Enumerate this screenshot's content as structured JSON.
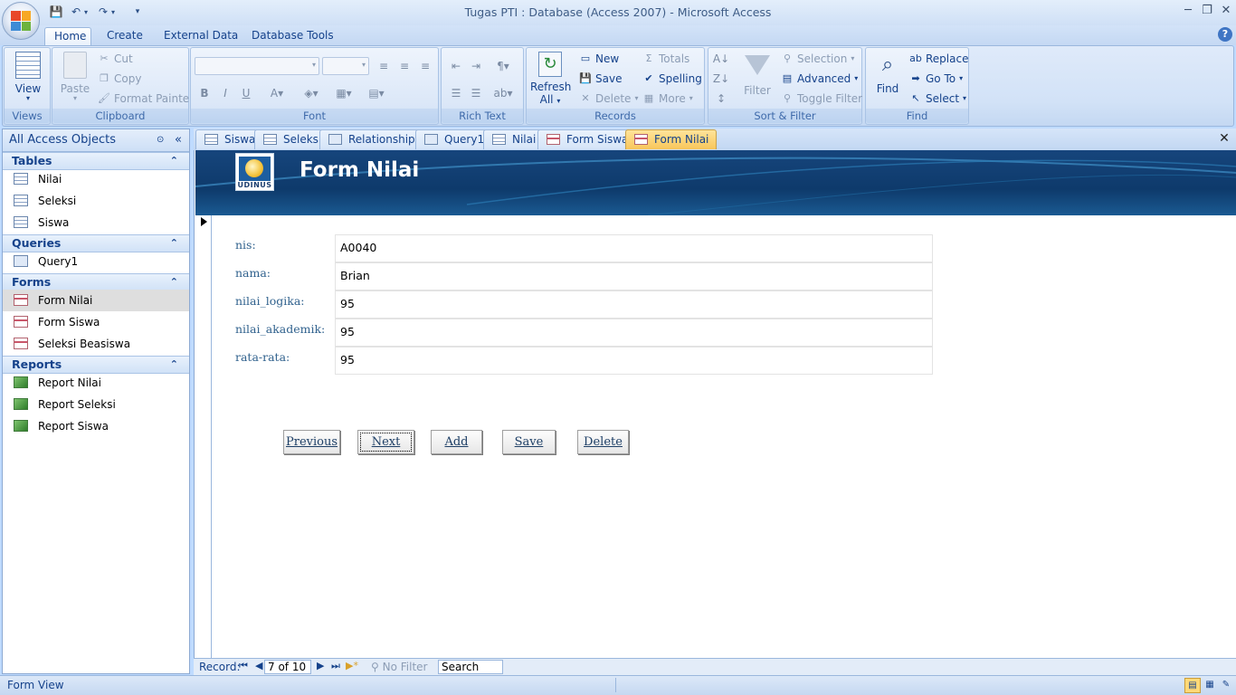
{
  "window": {
    "title": "Tugas PTI : Database (Access 2007) - Microsoft Access",
    "minimize": "─",
    "restore": "❐",
    "close": "✕"
  },
  "ribbon_tabs": [
    "Home",
    "Create",
    "External Data",
    "Database Tools"
  ],
  "groups": {
    "views": {
      "label": "Views",
      "view": "View"
    },
    "clipboard": {
      "label": "Clipboard",
      "paste": "Paste",
      "cut": "Cut",
      "copy": "Copy",
      "format_painter": "Format Painter"
    },
    "font": {
      "label": "Font"
    },
    "rich_text": {
      "label": "Rich Text"
    },
    "records": {
      "label": "Records",
      "refresh": "Refresh",
      "refresh2": "All",
      "new": "New",
      "save": "Save",
      "delete": "Delete",
      "totals": "Totals",
      "spelling": "Spelling",
      "more": "More"
    },
    "sort_filter": {
      "label": "Sort & Filter",
      "filter": "Filter",
      "selection": "Selection",
      "advanced": "Advanced",
      "toggle_filter": "Toggle Filter"
    },
    "find": {
      "label": "Find",
      "find": "Find",
      "replace": "Replace",
      "goto": "Go To",
      "select": "Select"
    }
  },
  "nav": {
    "header": "All Access Objects",
    "tables": {
      "title": "Tables",
      "items": [
        "Nilai",
        "Seleksi",
        "Siswa"
      ]
    },
    "queries": {
      "title": "Queries",
      "items": [
        "Query1"
      ]
    },
    "forms": {
      "title": "Forms",
      "items": [
        "Form Nilai",
        "Form Siswa",
        "Seleksi Beasiswa"
      ]
    },
    "reports": {
      "title": "Reports",
      "items": [
        "Report Nilai",
        "Report Seleksi",
        "Report Siswa"
      ]
    }
  },
  "doc_tabs": [
    "Siswa",
    "Seleksi",
    "Relationships",
    "Query1",
    "Nilai",
    "Form Siswa",
    "Form Nilai"
  ],
  "form": {
    "title": "Form Nilai",
    "logo_text": "UDINUS",
    "fields": [
      {
        "label": "nis:",
        "value": "A0040"
      },
      {
        "label": "nama:",
        "value": "Brian"
      },
      {
        "label": "nilai_logika:",
        "value": "95"
      },
      {
        "label": "nilai_akademik:",
        "value": "95"
      },
      {
        "label": "rata-rata:",
        "value": "95"
      }
    ],
    "buttons": {
      "previous": "Previous",
      "next": "Next",
      "add": "Add",
      "save": "Save",
      "delete": "Delete"
    }
  },
  "record_nav": {
    "label": "Record:",
    "position": "7 of 10",
    "filter": "No Filter",
    "search": "Search"
  },
  "status": {
    "text": "Form View"
  },
  "colors": {
    "header_band": "#0e3a6b",
    "active_tab": "#f8c65a",
    "ribbon": "#dfeafa"
  }
}
